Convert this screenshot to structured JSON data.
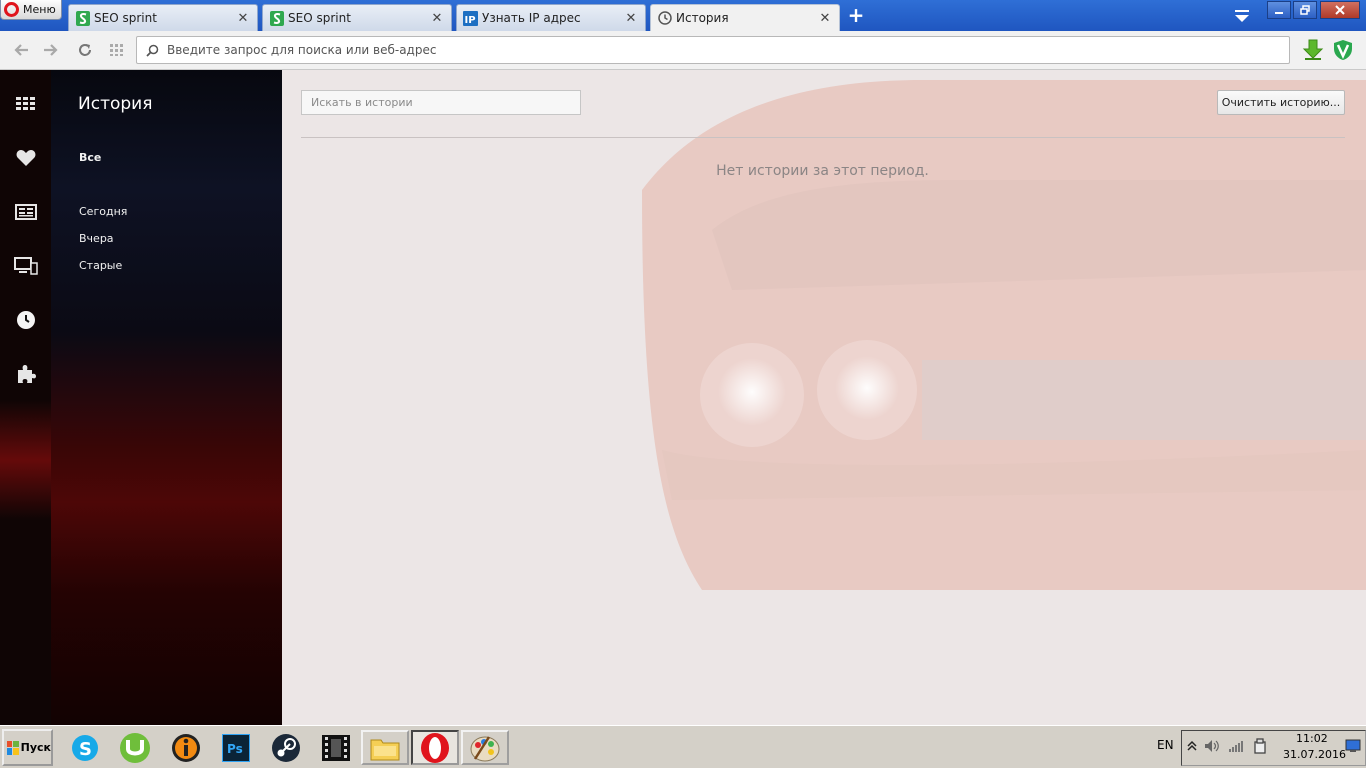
{
  "browser": {
    "menu_label": "Меню",
    "tabs": [
      {
        "title": "SEO sprint",
        "icon": "seosprint-icon",
        "active": false
      },
      {
        "title": "SEO sprint",
        "icon": "seosprint-icon",
        "active": false
      },
      {
        "title": "Узнать IP адрес",
        "icon": "ip-icon",
        "active": false
      },
      {
        "title": "История",
        "icon": "clock-icon",
        "active": true
      }
    ],
    "tab_close_glyph": "✕",
    "new_tab_glyph": "+",
    "address_placeholder": "Введите запрос для поиска или веб-адрес",
    "accent_color": "#2f6fd6"
  },
  "sidebar": {
    "icons": [
      "speed-dial-icon",
      "heart-icon",
      "news-icon",
      "sync-devices-icon",
      "history-clock-icon",
      "extensions-icon"
    ]
  },
  "history_panel": {
    "title": "История",
    "filters": [
      {
        "label": "Все",
        "selected": true
      },
      {
        "label": "Сегодня",
        "selected": false
      },
      {
        "label": "Вчера",
        "selected": false
      },
      {
        "label": "Старые",
        "selected": false
      }
    ]
  },
  "main": {
    "search_placeholder": "Искать в истории",
    "clear_button_label": "Очистить историю...",
    "empty_message": "Нет истории за этот период."
  },
  "taskbar": {
    "start_label": "Пуск",
    "apps": [
      "skype-icon",
      "utorrent-icon",
      "info-app-icon",
      "photoshop-icon",
      "steam-icon",
      "video-editor-icon",
      "file-explorer-icon",
      "opera-icon",
      "paint-icon"
    ],
    "photoshop_label": "Ps",
    "language": "EN",
    "time": "11:02",
    "date": "31.07.2016"
  }
}
